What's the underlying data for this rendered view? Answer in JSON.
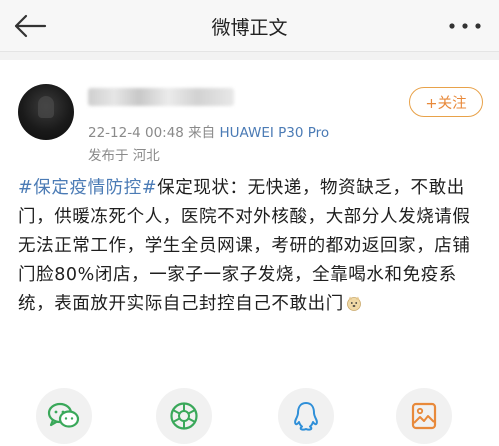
{
  "header": {
    "title": "微博正文",
    "back_icon": "back-arrow-icon",
    "more_icon": "more-dots-icon"
  },
  "post": {
    "meta_date_source": "22-12-4 00:48  来自 ",
    "device": "HUAWEI P30 Pro",
    "location": "发布于 河北",
    "follow_label": "+关注",
    "hashtag": "#保定疫情防控#",
    "body_text": "保定现状：无快递，物资缺乏，不敢出门，供暖冻死个人，医院不对外核酸，大部分人发烧请假无法正常工作，学生全员网课，考研的都劝返回家，店铺门脸80%闭店，一家子一家子发烧，全靠喝水和免疫系统，表面放开实际自己封控自己不敢出门",
    "trailing_emoji": "doge-emoji-icon"
  },
  "share": {
    "items": [
      {
        "icon": "wechat-icon",
        "color": "#3aa85a"
      },
      {
        "icon": "moments-icon",
        "color": "#3aa85a"
      },
      {
        "icon": "qq-icon",
        "color": "#2f8fd8"
      },
      {
        "icon": "save-image-icon",
        "color": "#e8893a"
      }
    ]
  }
}
